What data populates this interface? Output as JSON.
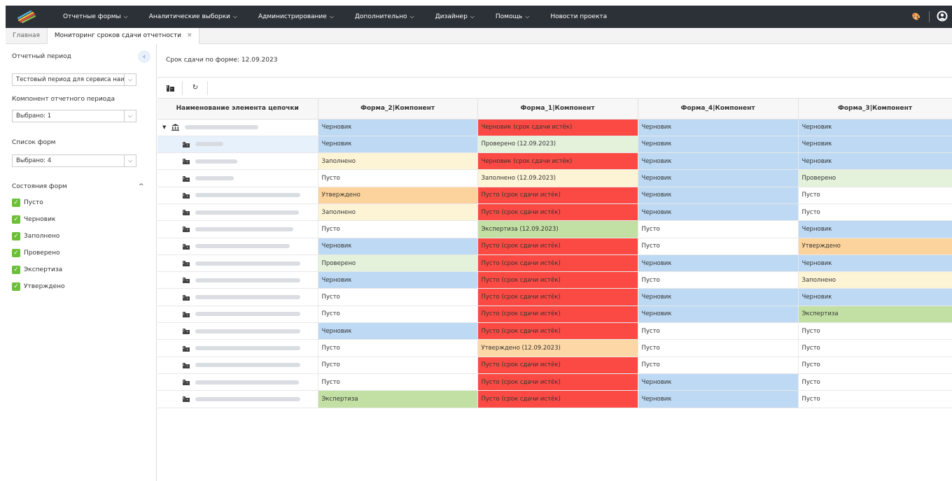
{
  "nav": {
    "items": [
      {
        "label": "Отчетные формы",
        "dropdown": true
      },
      {
        "label": "Аналитические выборки",
        "dropdown": true
      },
      {
        "label": "Администрирование",
        "dropdown": true
      },
      {
        "label": "Дополнительно",
        "dropdown": true
      },
      {
        "label": "Дизайнер",
        "dropdown": true
      },
      {
        "label": "Помощь",
        "dropdown": true
      },
      {
        "label": "Новости проекта",
        "dropdown": false
      }
    ]
  },
  "tabs": [
    {
      "label": "Главная",
      "closable": false
    },
    {
      "label": "Мониторинг сроков сдачи отчетности",
      "closable": true
    }
  ],
  "sidebar": {
    "period_label": "Отчетный период",
    "period_value": "Тестовый период для сервиса наим",
    "component_label": "Компонент отчетного периода",
    "component_value": "Выбрано: 1",
    "forms_label": "Список форм",
    "forms_value": "Выбрано: 4",
    "states_label": "Состояния форм",
    "states": [
      "Пусто",
      "Черновик",
      "Заполнено",
      "Проверено",
      "Экспертиза",
      "Утверждено"
    ]
  },
  "main": {
    "deadline": "Срок сдачи по форме: 12.09.2023"
  },
  "table": {
    "headers": [
      "Наименование элемента цепочки",
      "Форма_2|Компонент",
      "Форма_1|Компонент",
      "Форма_4|Компонент",
      "Форма_3|Компонент"
    ],
    "rows": [
      {
        "cells": [
          "Черновик",
          "Черновик (срок сдачи истёк)",
          "Черновик",
          "Черновик"
        ],
        "colors": [
          "draft",
          "red",
          "draft",
          "draft"
        ]
      },
      {
        "cells": [
          "Черновик",
          "Проверено (12.09.2023)",
          "Черновик",
          "Черновик"
        ],
        "colors": [
          "draft",
          "checked",
          "draft",
          "draft"
        ]
      },
      {
        "cells": [
          "Заполнено",
          "Черновик (срок сдачи истёк)",
          "Черновик",
          "Черновик"
        ],
        "colors": [
          "filled",
          "red",
          "draft",
          "draft"
        ]
      },
      {
        "cells": [
          "Пусто",
          "Заполнено (12.09.2023)",
          "Черновик",
          "Проверено"
        ],
        "colors": [
          "empty",
          "filled",
          "draft",
          "checked"
        ]
      },
      {
        "cells": [
          "Утверждено",
          "Пусто (срок сдачи истёк)",
          "Черновик",
          "Пусто"
        ],
        "colors": [
          "approved",
          "red",
          "draft",
          "empty"
        ]
      },
      {
        "cells": [
          "Заполнено",
          "Пусто (срок сдачи истёк)",
          "Черновик",
          "Пусто"
        ],
        "colors": [
          "filled",
          "red",
          "draft",
          "empty"
        ]
      },
      {
        "cells": [
          "Пусто",
          "Экспертиза (12.09.2023)",
          "Пусто",
          "Черновик"
        ],
        "colors": [
          "empty",
          "exam",
          "empty",
          "draft"
        ]
      },
      {
        "cells": [
          "Черновик",
          "Пусто (срок сдачи истёк)",
          "Пусто",
          "Утверждено"
        ],
        "colors": [
          "draft",
          "red",
          "empty",
          "approved"
        ]
      },
      {
        "cells": [
          "Проверено",
          "Пусто (срок сдачи истёк)",
          "Черновик",
          "Черновик"
        ],
        "colors": [
          "checked",
          "red",
          "draft",
          "draft"
        ]
      },
      {
        "cells": [
          "Черновик",
          "Пусто (срок сдачи истёк)",
          "Пусто",
          "Заполнено"
        ],
        "colors": [
          "draft",
          "red",
          "empty",
          "filled"
        ]
      },
      {
        "cells": [
          "Пусто",
          "Пусто (срок сдачи истёк)",
          "Черновик",
          "Черновик"
        ],
        "colors": [
          "empty",
          "red",
          "draft",
          "draft"
        ]
      },
      {
        "cells": [
          "Пусто",
          "Пусто (срок сдачи истёк)",
          "Черновик",
          "Экспертиза"
        ],
        "colors": [
          "empty",
          "red",
          "draft",
          "exam"
        ]
      },
      {
        "cells": [
          "Черновик",
          "Пусто (срок сдачи истёк)",
          "Пусто",
          "Пусто"
        ],
        "colors": [
          "draft",
          "red",
          "empty",
          "empty"
        ]
      },
      {
        "cells": [
          "Пусто",
          "Утверждено (12.09.2023)",
          "Пусто",
          "Пусто"
        ],
        "colors": [
          "empty",
          "appdate",
          "empty",
          "empty"
        ]
      },
      {
        "cells": [
          "Пусто",
          "Пусто (срок сдачи истёк)",
          "Пусто",
          "Пусто"
        ],
        "colors": [
          "empty",
          "red",
          "empty",
          "empty"
        ]
      },
      {
        "cells": [
          "Пусто",
          "Пусто (срок сдачи истёк)",
          "Черновик",
          "Пусто"
        ],
        "colors": [
          "empty",
          "red",
          "draft",
          "empty"
        ]
      },
      {
        "cells": [
          "Экспертиза",
          "Пусто (срок сдачи истёк)",
          "Черновик",
          "Пусто"
        ],
        "colors": [
          "exam",
          "red",
          "draft",
          "empty"
        ]
      }
    ]
  },
  "colors": {
    "draft": "#bdd9f3",
    "red": "#fb4a43",
    "checked": "#e4f2dc",
    "filled": "#fdf3d5",
    "empty": "#ffffff",
    "approved": "#fcd39c",
    "exam": "#c3e0a4",
    "appdate": "#fdd8a6",
    "navbar": "#2c3137",
    "check_green": "#6cbf3a"
  },
  "icons": {
    "logo": "stripes-logo-icon",
    "palette": "palette-icon",
    "user": "user-account-icon",
    "tree": "org-tree-icon",
    "refresh": "refresh-icon",
    "root": "institution-icon",
    "item": "building-icon"
  }
}
